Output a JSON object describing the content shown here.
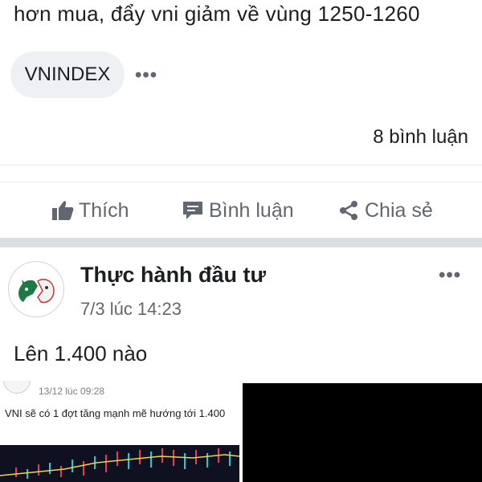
{
  "post1": {
    "text": "hơn mua, đẩy vni giảm về vùng 1250-1260",
    "tag": "VNINDEX",
    "more_label": "•••",
    "comment_count": "8 bình luận",
    "actions": {
      "like": "Thích",
      "comment": "Bình luận",
      "share": "Chia sẻ"
    }
  },
  "post2": {
    "author": "Thực hành đầu tư",
    "timestamp": "7/3 lúc 14:23",
    "more_label": "•••",
    "text": "Lên 1.400 nào",
    "embed": {
      "timestamp": "13/12 lúc 09:28",
      "text": "VNI sẽ có 1 đợt tăng mạnh mẽ hướng tới 1.400"
    }
  },
  "colors": {
    "primary_text": "#1c1e21",
    "secondary_text": "#606770",
    "pill_bg": "#eef0f3",
    "separator": "#dadde1",
    "chart_bg": "#0f1020"
  },
  "icons": [
    "thumbs-up-icon",
    "comment-icon",
    "share-icon",
    "more-icon",
    "bull-bear-logo"
  ]
}
